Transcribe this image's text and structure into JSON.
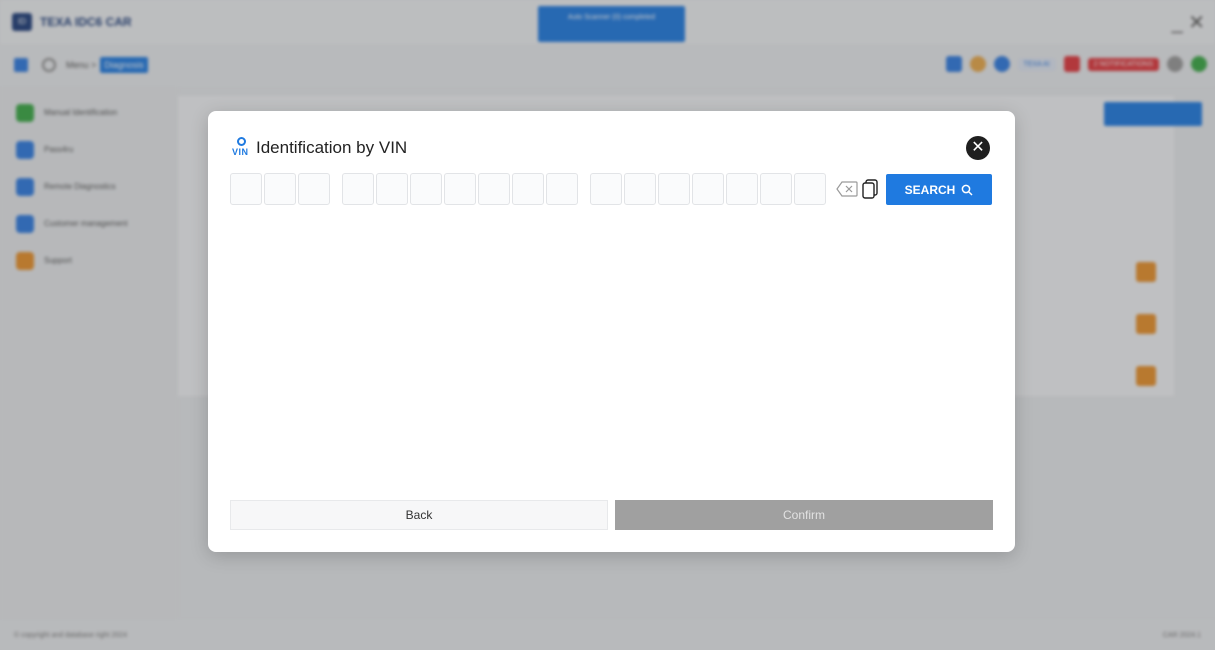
{
  "app": {
    "title": "TEXA IDC6 CAR",
    "toast": "Auto Scanner (0) completed",
    "breadcrumb": {
      "menu": "Menu >",
      "active": "Diagnosis"
    },
    "toolbar_right": {
      "texa_ai": "TEXA AI",
      "notifications": "2 NOTIFICATIONS"
    },
    "sidebar": [
      {
        "label": "Manual Identification",
        "color": "#3aa845"
      },
      {
        "label": "Pass4ru",
        "color": "#2f7be0"
      },
      {
        "label": "Remote Diagnostics",
        "color": "#2f7be0"
      },
      {
        "label": "Customer management",
        "color": "#2f7be0"
      },
      {
        "label": "Support",
        "color": "#e8902a"
      }
    ],
    "footer": "© copyright and database right 2024",
    "footer_right": "CAR 2024.1"
  },
  "modal": {
    "title": "Identification by VIN",
    "vin_icon_text": "VIN",
    "search_label": "SEARCH",
    "back_label": "Back",
    "confirm_label": "Confirm",
    "vin_groups": [
      3,
      7,
      7
    ],
    "close_glyph": "✕"
  },
  "colors": {
    "accent": "#1f7ae0",
    "confirm_disabled": "#a0a0a0"
  }
}
